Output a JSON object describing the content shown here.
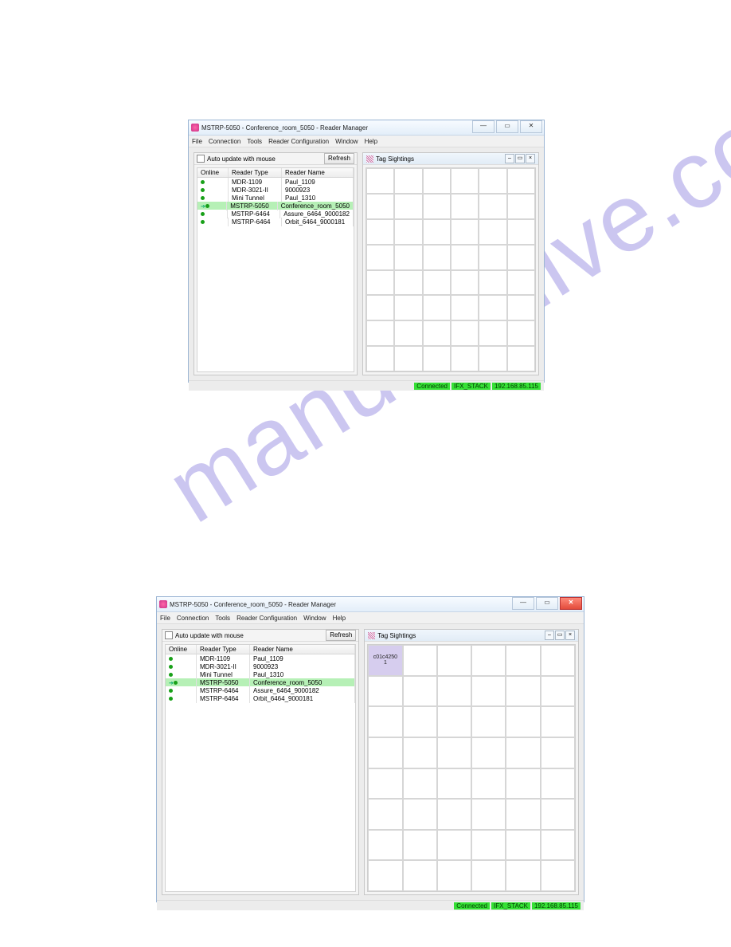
{
  "watermarkText": "manualshive.com",
  "windows": [
    {
      "title": "MSTRP-5050 - Conference_room_5050 - Reader Manager",
      "winControlsStyle": "classic",
      "menus": [
        "File",
        "Connection",
        "Tools",
        "Reader Configuration",
        "Window",
        "Help"
      ],
      "autoUpdateLabel": "Auto update with mouse",
      "refreshLabel": "Refresh",
      "columns": [
        "Online",
        "Reader Type",
        "Reader Name"
      ],
      "rows": [
        {
          "online": true,
          "type": "MDR-1109",
          "name": "Paul_1109",
          "sel": false,
          "arrow": false
        },
        {
          "online": true,
          "type": "MDR-3021-II",
          "name": "9000923",
          "sel": false,
          "arrow": false
        },
        {
          "online": true,
          "type": "Mini Tunnel",
          "name": "Paul_1310",
          "sel": false,
          "arrow": false
        },
        {
          "online": true,
          "type": "MSTRP-5050",
          "name": "Conference_room_5050",
          "sel": true,
          "arrow": true
        },
        {
          "online": true,
          "type": "MSTRP-6464",
          "name": "Assure_6464_9000182",
          "sel": false,
          "arrow": false
        },
        {
          "online": true,
          "type": "MSTRP-6464",
          "name": "Orbit_6464_9000181",
          "sel": false,
          "arrow": false
        }
      ],
      "rightPanelTitle": "Tag Sightings",
      "gridRows": 8,
      "gridCols": 6,
      "tags": [],
      "status": {
        "connected": "Connected",
        "stack": "IFX_STACK",
        "ip": "192.168.85.115"
      }
    },
    {
      "title": "MSTRP-5050 - Conference_room_5050 - Reader Manager",
      "winControlsStyle": "win7",
      "menus": [
        "File",
        "Connection",
        "Tools",
        "Reader Configuration",
        "Window",
        "Help"
      ],
      "autoUpdateLabel": "Auto update with mouse",
      "refreshLabel": "Refresh",
      "columns": [
        "Online",
        "Reader Type",
        "Reader Name"
      ],
      "rows": [
        {
          "online": true,
          "type": "MDR-1109",
          "name": "Paul_1109",
          "sel": false,
          "arrow": false
        },
        {
          "online": true,
          "type": "MDR-3021-II",
          "name": "9000923",
          "sel": false,
          "arrow": false
        },
        {
          "online": true,
          "type": "Mini Tunnel",
          "name": "Paul_1310",
          "sel": false,
          "arrow": false
        },
        {
          "online": true,
          "type": "MSTRP-5050",
          "name": "Conference_room_5050",
          "sel": true,
          "arrow": true
        },
        {
          "online": true,
          "type": "MSTRP-6464",
          "name": "Assure_6464_9000182",
          "sel": false,
          "arrow": false
        },
        {
          "online": true,
          "type": "MSTRP-6464",
          "name": "Orbit_6464_9000181",
          "sel": false,
          "arrow": false
        }
      ],
      "rightPanelTitle": "Tag Sightings",
      "gridRows": 8,
      "gridCols": 6,
      "tags": [
        {
          "row": 0,
          "col": 0,
          "id": "c01c4250",
          "count": "1"
        }
      ],
      "status": {
        "connected": "Connected",
        "stack": "IFX_STACK",
        "ip": "192.168.85.115"
      }
    }
  ]
}
